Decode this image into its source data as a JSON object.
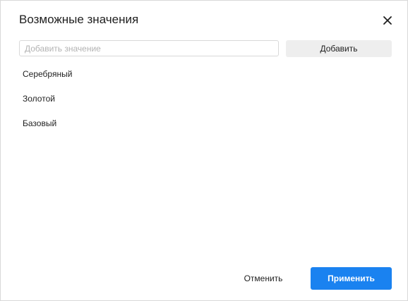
{
  "dialog": {
    "title": "Возможные значения",
    "close_icon": "close-icon"
  },
  "add": {
    "placeholder": "Добавить значение",
    "value": "",
    "button_label": "Добавить"
  },
  "values": [
    "Серебряный",
    "Золотой",
    "Базовый"
  ],
  "footer": {
    "cancel_label": "Отменить",
    "apply_label": "Применить"
  },
  "colors": {
    "accent": "#1a82f0",
    "secondary_button": "#eeeeee",
    "text": "#1f1f1f",
    "placeholder": "#b3b3b3"
  }
}
